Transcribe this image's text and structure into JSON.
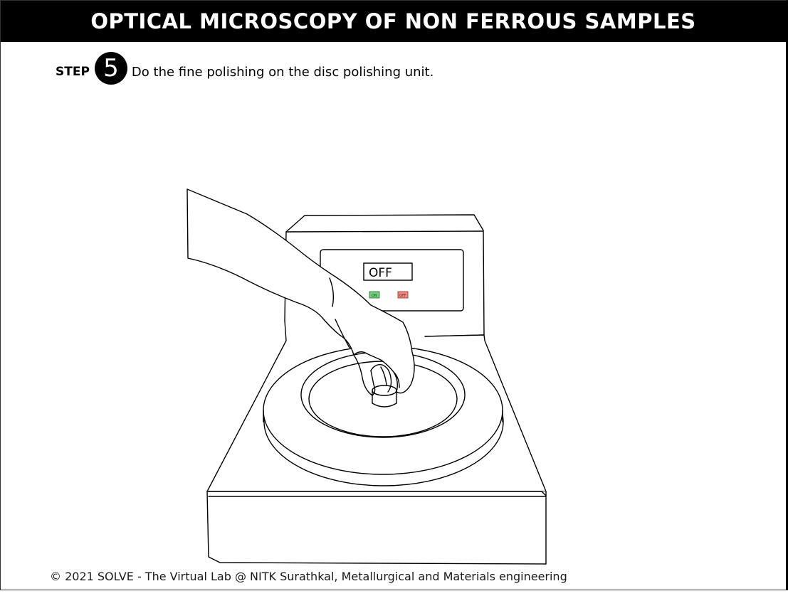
{
  "header": {
    "title": "OPTICAL MICROSCOPY OF NON FERROUS SAMPLES"
  },
  "step": {
    "label": "STEP",
    "number": "5",
    "instruction": "Do the fine polishing on the disc polishing unit."
  },
  "machine": {
    "display_text": "OFF",
    "on_button_label": "ON",
    "off_button_label": "OFF",
    "on_button_color": "#6fcf7a",
    "off_button_color": "#f08a80",
    "power_state": "off"
  },
  "footer": {
    "copyright": "© 2021 SOLVE - The Virtual Lab @ NITK Surathkal, Metallurgical and Materials engineering"
  }
}
